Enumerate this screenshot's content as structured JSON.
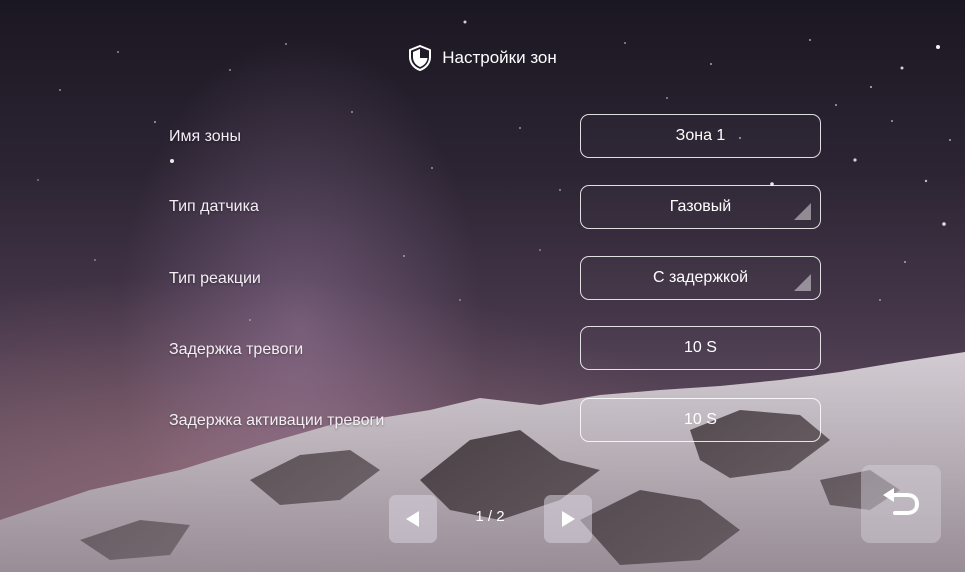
{
  "header": {
    "title": "Настройки зон",
    "icon": "shield-icon"
  },
  "settings": [
    {
      "label": "Имя зоны",
      "value": "Зона 1",
      "dropdown": false
    },
    {
      "label": "Тип датчика",
      "value": "Газовый",
      "dropdown": true
    },
    {
      "label": "Тип реакции",
      "value": "С задержкой",
      "dropdown": true
    },
    {
      "label": "Задержка тревоги",
      "value": "10 S",
      "dropdown": false
    },
    {
      "label": "Задержка активации тревоги",
      "value": "10 S",
      "dropdown": false
    }
  ],
  "pagination": {
    "indicator": "1 / 2",
    "prev_icon": "arrow-left-icon",
    "next_icon": "arrow-right-icon"
  },
  "back_button": {
    "icon": "back-arrow-icon"
  },
  "colors": {
    "text": "#ffffff",
    "button_bg": "#d7d2dc",
    "field_border": "#ffffff"
  }
}
